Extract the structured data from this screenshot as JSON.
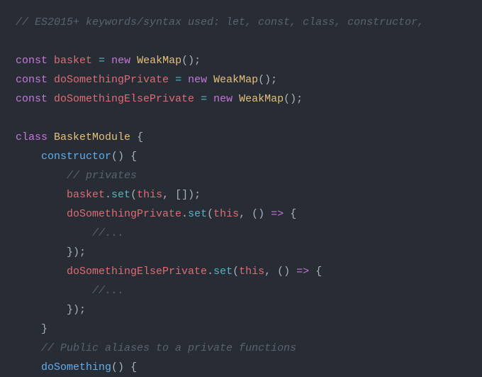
{
  "code": {
    "lines": [
      {
        "type": "comment",
        "indent": 0,
        "content": "// ES2015+ keywords/syntax used: let, const, class, constructor,"
      },
      {
        "type": "blank"
      },
      {
        "type": "const-new",
        "indent": 0,
        "var": "basket",
        "class": "WeakMap"
      },
      {
        "type": "const-new",
        "indent": 0,
        "var": "doSomethingPrivate",
        "class": "WeakMap"
      },
      {
        "type": "const-new",
        "indent": 0,
        "var": "doSomethingElsePrivate",
        "class": "WeakMap"
      },
      {
        "type": "blank"
      },
      {
        "type": "class-decl",
        "indent": 0,
        "name": "BasketModule"
      },
      {
        "type": "constructor-open",
        "indent": 1
      },
      {
        "type": "comment",
        "indent": 2,
        "content": "// privates"
      },
      {
        "type": "set-array",
        "indent": 2,
        "obj": "basket"
      },
      {
        "type": "set-arrow-open",
        "indent": 2,
        "obj": "doSomethingPrivate"
      },
      {
        "type": "comment",
        "indent": 3,
        "content": "//..."
      },
      {
        "type": "close-arrow",
        "indent": 2
      },
      {
        "type": "set-arrow-open",
        "indent": 2,
        "obj": "doSomethingElsePrivate"
      },
      {
        "type": "comment",
        "indent": 3,
        "content": "//..."
      },
      {
        "type": "close-arrow",
        "indent": 2
      },
      {
        "type": "close-brace",
        "indent": 1
      },
      {
        "type": "comment",
        "indent": 1,
        "content": "// Public aliases to a private functions"
      },
      {
        "type": "method-open",
        "indent": 1,
        "name": "doSomething"
      }
    ]
  },
  "tokens": {
    "const": "const",
    "new": "new",
    "class": "class",
    "constructor": "constructor",
    "this": "this",
    "set": "set",
    "equals": " = ",
    "arrow": "=>",
    "empty_array": "[]",
    "open_paren": "(",
    "close_paren": ")",
    "open_brace": "{",
    "close_brace": "}",
    "close_arrow": "});",
    "semicolon": ";",
    "comma": ", ",
    "dot": "."
  }
}
